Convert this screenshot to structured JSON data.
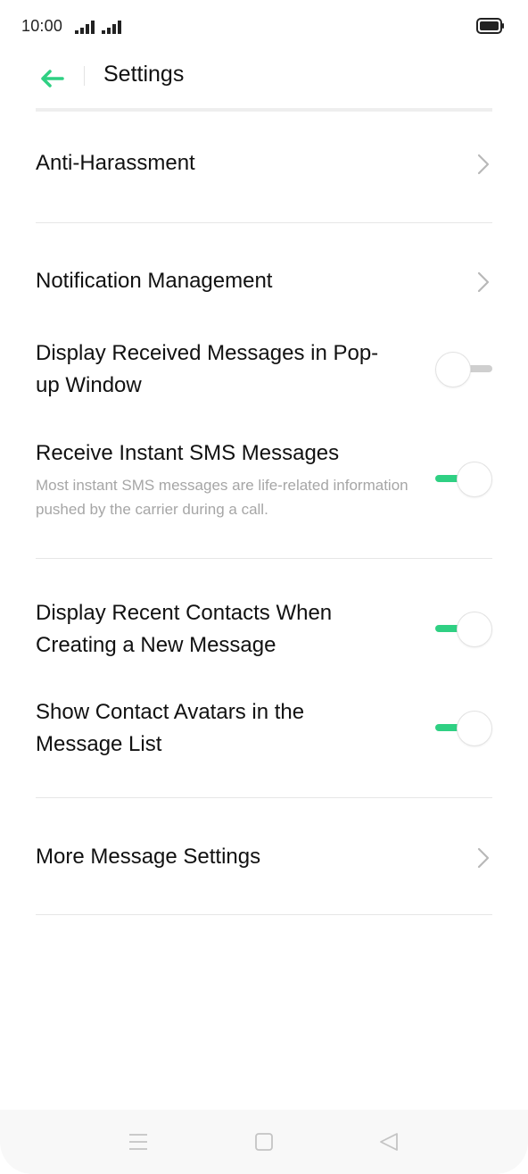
{
  "status_bar": {
    "time": "10:00"
  },
  "header": {
    "title": "Settings",
    "back_icon": "arrow-left-icon"
  },
  "colors": {
    "accent": "#2fd083",
    "text_primary": "#111111",
    "text_secondary": "#a6a6a6",
    "divider": "#e6e6e6",
    "toggle_off_track": "#cfcfcf"
  },
  "items": {
    "anti_harassment": {
      "label": "Anti-Harassment"
    },
    "notification_management": {
      "label": "Notification Management"
    },
    "popup_window": {
      "label": "Display Received Messages in Pop-up Window",
      "enabled": false
    },
    "instant_sms": {
      "label": "Receive Instant SMS Messages",
      "description": "Most instant SMS messages are life-related information pushed by the carrier during a call.",
      "enabled": true
    },
    "recent_contacts": {
      "label": "Display Recent Contacts When Creating a New Message",
      "enabled": true
    },
    "contact_avatars": {
      "label": "Show Contact Avatars in the Message List",
      "enabled": true
    },
    "more_settings": {
      "label": "More Message Settings"
    }
  },
  "nav_bar": {
    "menu_icon": "menu-icon",
    "home_icon": "home-square-icon",
    "back_icon": "back-triangle-icon"
  }
}
